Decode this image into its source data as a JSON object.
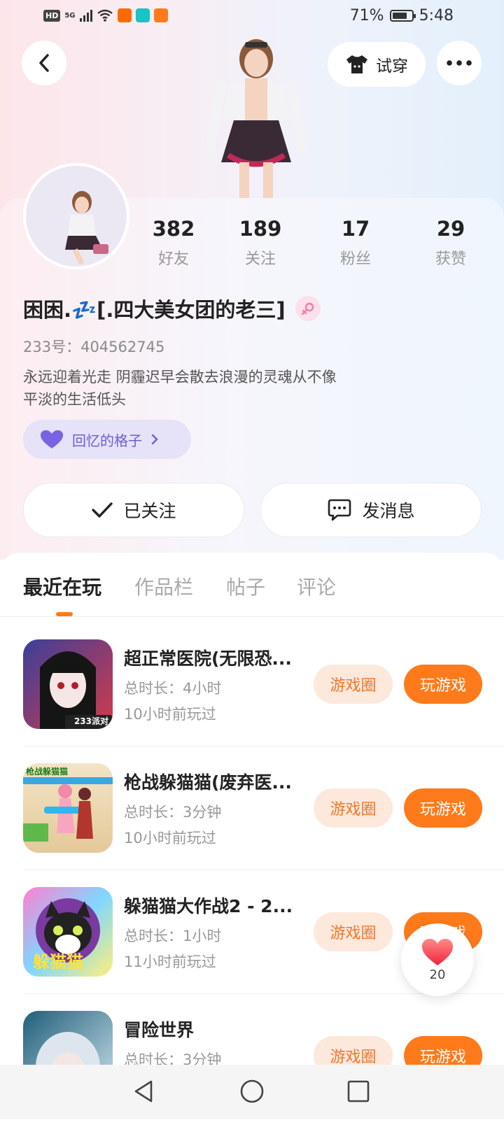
{
  "status_bar": {
    "hd": "HD",
    "network": "5G",
    "battery_percent": "71%",
    "time": "5:48"
  },
  "header": {
    "back_icon": "chevron-left-icon",
    "tryon_label": "试穿",
    "more_icon": "more-dots-icon"
  },
  "profile": {
    "nickname": "困困.💤[.四大美女团的老三]",
    "uid": "233号：404562745",
    "bio_line1": "永远迎着光走 阴霾迟早会散去浪漫的灵魂从不像",
    "bio_line2": "平淡的生活低头",
    "memory_label": "回忆的格子"
  },
  "stats": [
    {
      "value": "382",
      "label": "好友"
    },
    {
      "value": "189",
      "label": "关注"
    },
    {
      "value": "17",
      "label": "粉丝"
    },
    {
      "value": "29",
      "label": "获赞"
    }
  ],
  "actions": {
    "followed_label": "已关注",
    "message_label": "发消息"
  },
  "tabs": [
    "最近在玩",
    "作品栏",
    "帖子",
    "评论"
  ],
  "games": [
    {
      "title": "超正常医院(无限恐...",
      "duration": "总时长：4小时",
      "last_played": "10小时前玩过",
      "circle_label": "游戏圈",
      "play_label": "玩游戏",
      "icon_tag": "233派对"
    },
    {
      "title": "枪战躲猫猫(废弃医...",
      "duration": "总时长：3分钟",
      "last_played": "10小时前玩过",
      "circle_label": "游戏圈",
      "play_label": "玩游戏",
      "icon_tag": "枪战躲猫猫"
    },
    {
      "title": "躲猫猫大作战2 - 2...",
      "duration": "总时长：1小时",
      "last_played": "11小时前玩过",
      "circle_label": "游戏圈",
      "play_label": "玩游戏",
      "icon_tag": "躲猫猫"
    },
    {
      "title": "冒险世界",
      "duration": "总时长：3分钟",
      "last_played": "",
      "circle_label": "游戏圈",
      "play_label": "玩游戏",
      "icon_tag": ""
    }
  ],
  "like_float": {
    "count": "20"
  },
  "colors": {
    "accent_orange": "#ff7a1a",
    "circle_btn_bg": "#fde8dc",
    "memory_purple": "#6d5fd0"
  }
}
